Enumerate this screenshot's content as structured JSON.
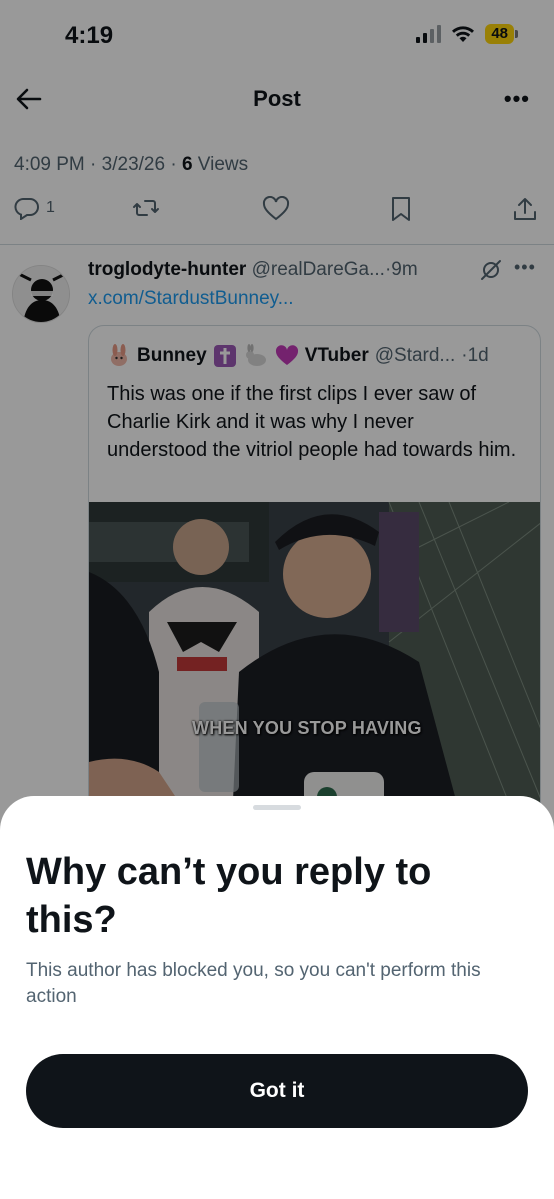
{
  "status_bar": {
    "time": "4:19",
    "battery": "48"
  },
  "header": {
    "title": "Post"
  },
  "post_meta": {
    "time": "4:09 PM",
    "sep1": " · ",
    "date": "3/23/26",
    "sep2": " · ",
    "views_count": "6",
    "views_label": " Views"
  },
  "actions": {
    "reply_count": "1"
  },
  "reply": {
    "name": "troglodyte-hunter",
    "handle": "@realDareGa...",
    "age": "·9m",
    "link": "x.com/StardustBunney..."
  },
  "quote": {
    "name": "Bunney",
    "name_suffix": "VTuber",
    "handle": "@Stard...",
    "age": "·1d",
    "text": "This was one if the first clips I ever saw of Charlie Kirk and it was why I never understood the vitriol people had towards him.",
    "video_caption": "WHEN YOU STOP HAVING"
  },
  "sheet": {
    "title": "Why can’t you reply to this?",
    "body": "This author has blocked you, so you can't perform this action",
    "button_label": "Got it"
  },
  "colors": {
    "link": "#1d9bf0",
    "battery": "#ffd60a",
    "button": "#0f1419"
  }
}
